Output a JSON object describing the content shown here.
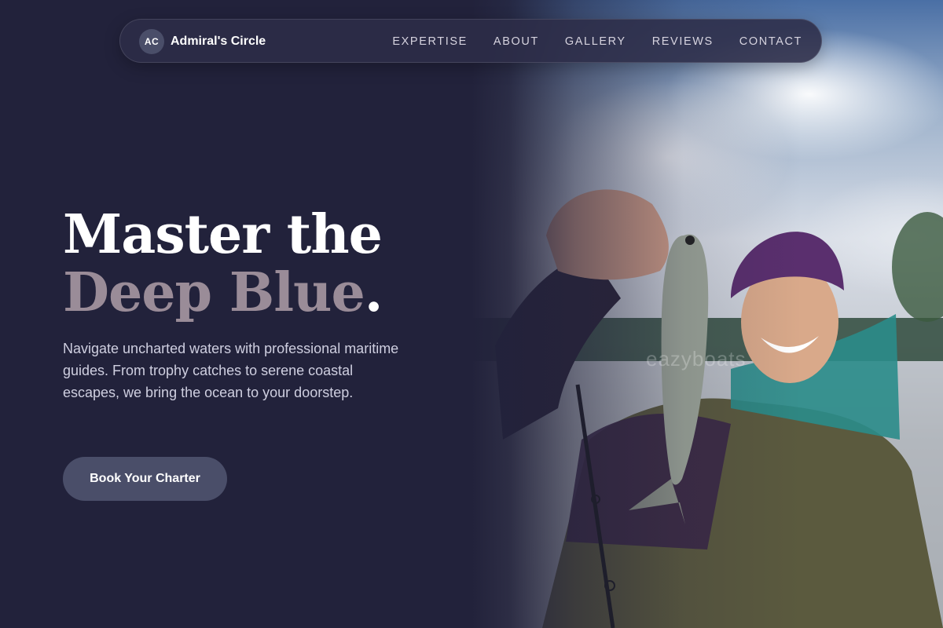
{
  "brand": {
    "logo_initials": "AC",
    "name": "Admiral's Circle"
  },
  "nav": {
    "items": [
      {
        "label": "EXPERTISE"
      },
      {
        "label": "ABOUT"
      },
      {
        "label": "GALLERY"
      },
      {
        "label": "REVIEWS"
      },
      {
        "label": "CONTACT"
      }
    ]
  },
  "hero": {
    "title_line1": "Master the",
    "title_line2": "Deep Blue",
    "title_period": ".",
    "description": "Navigate uncharted waters with professional maritime guides. From trophy catches to serene coastal escapes, we bring the ocean to your doorstep.",
    "cta_label": "Book Your Charter",
    "image_watermark": "eazyboats"
  },
  "colors": {
    "background": "#22223b",
    "accent_muted": "#9a8c98",
    "button": "#4a4e69",
    "text_light": "#cfcfe0"
  }
}
